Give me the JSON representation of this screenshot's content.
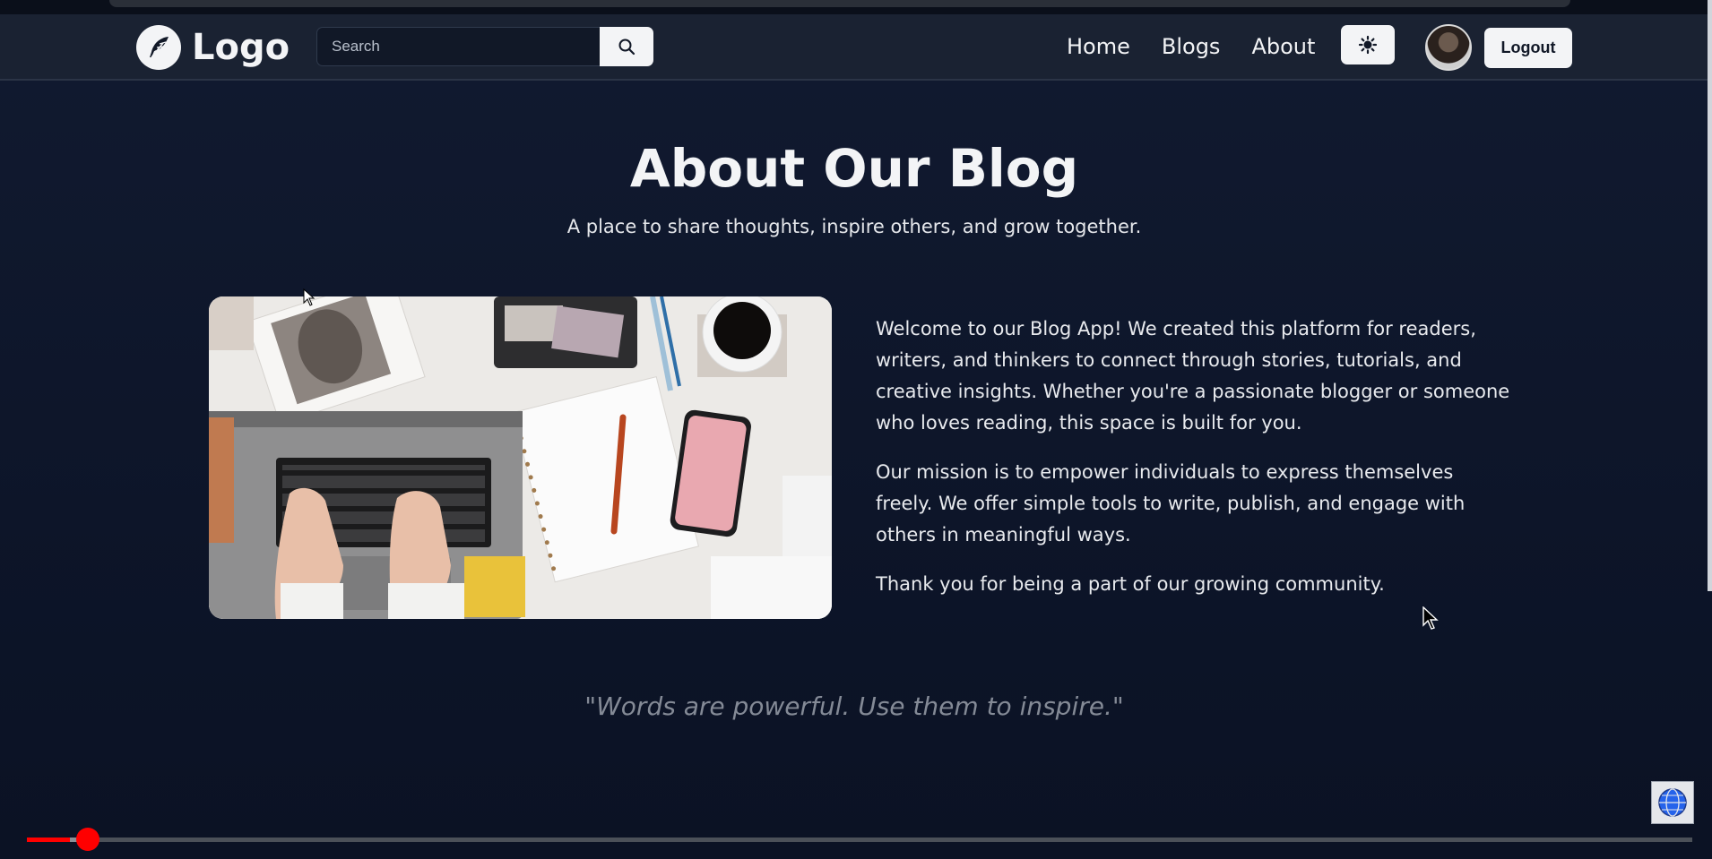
{
  "navbar": {
    "logo_text": "Logo",
    "search_placeholder": "Search",
    "links": [
      "Home",
      "Blogs",
      "About"
    ],
    "logout_label": "Logout"
  },
  "hero": {
    "title": "About Our Blog",
    "subtitle": "A place to share thoughts, inspire others, and grow together."
  },
  "content": {
    "paragraphs": [
      "Welcome to our Blog App! We created this platform for readers, writers, and thinkers to connect through stories, tutorials, and creative insights. Whether you're a passionate blogger or someone who loves reading, this space is built for you.",
      "Our mission is to empower individuals to express themselves freely. We offer simple tools to write, publish, and engage with others in meaningful ways.",
      "Thank you for being a part of our growing community."
    ],
    "quote": "\"Words are powerful. Use them to inspire.\""
  },
  "video_progress": {
    "played_fraction": 0.026,
    "buffered_fraction": 0.042
  },
  "colors": {
    "page_bg": "#0c1428",
    "navbar_bg": "#1a2232",
    "button_bg": "#f3f4f6",
    "progress_played": "#ff0000"
  },
  "icons": {
    "logo": "feather-icon",
    "search": "search-icon",
    "theme": "sun-icon",
    "corner": "globe-icon"
  }
}
